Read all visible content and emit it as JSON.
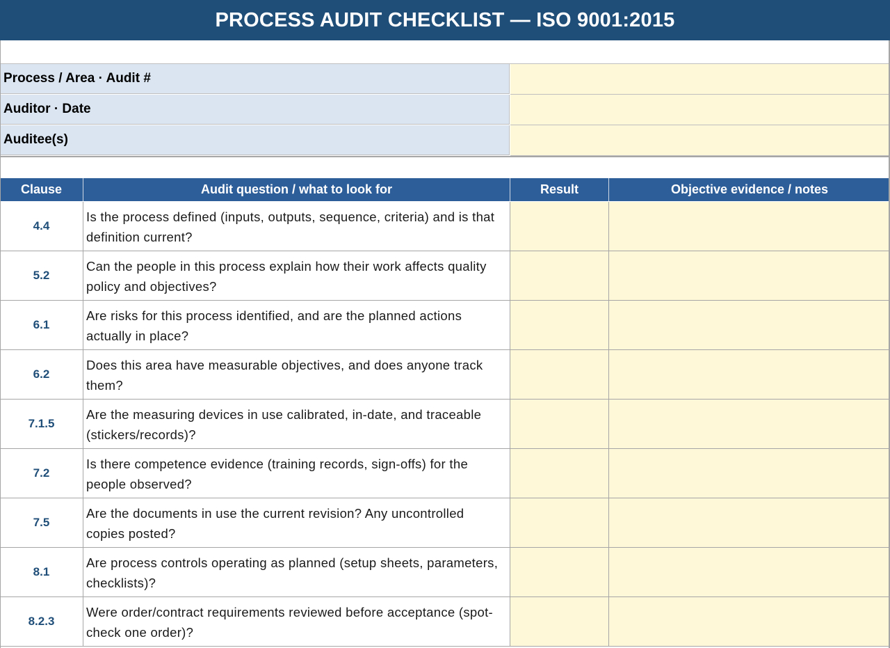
{
  "title": "PROCESS AUDIT CHECKLIST — ISO 9001:2015",
  "info_fields": [
    {
      "label": "Process / Area  ·  Audit #",
      "value": ""
    },
    {
      "label": "Auditor  ·  Date",
      "value": ""
    },
    {
      "label": "Auditee(s)",
      "value": ""
    }
  ],
  "table": {
    "headers": {
      "clause": "Clause",
      "question": "Audit question / what to look for",
      "result": "Result",
      "notes": "Objective evidence / notes"
    },
    "rows": [
      {
        "clause": "4.4",
        "question": "Is the process defined (inputs, outputs, sequence, criteria) and is that definition current?",
        "result": "",
        "notes": ""
      },
      {
        "clause": "5.2",
        "question": "Can the people in this process explain how their work affects quality policy and objectives?",
        "result": "",
        "notes": ""
      },
      {
        "clause": "6.1",
        "question": "Are risks for this process identified, and are the planned actions actually in place?",
        "result": "",
        "notes": ""
      },
      {
        "clause": "6.2",
        "question": "Does this area have measurable objectives, and does anyone track them?",
        "result": "",
        "notes": ""
      },
      {
        "clause": "7.1.5",
        "question": "Are the measuring devices in use calibrated, in-date, and traceable (stickers/records)?",
        "result": "",
        "notes": ""
      },
      {
        "clause": "7.2",
        "question": "Is there competence evidence (training records, sign-offs) for the people observed?",
        "result": "",
        "notes": ""
      },
      {
        "clause": "7.5",
        "question": "Are the documents in use the current revision? Any uncontrolled copies posted?",
        "result": "",
        "notes": ""
      },
      {
        "clause": "8.1",
        "question": "Are process controls operating as planned (setup sheets, parameters, checklists)?",
        "result": "",
        "notes": ""
      },
      {
        "clause": "8.2.3",
        "question": "Were order/contract requirements reviewed before acceptance (spot-check one order)?",
        "result": "",
        "notes": ""
      }
    ]
  },
  "colors": {
    "title_bg": "#1f4e79",
    "header_bg": "#2e5e99",
    "label_bg": "#dae5f1",
    "input_bg": "#fef7d8",
    "clause_text": "#1f4e79"
  }
}
